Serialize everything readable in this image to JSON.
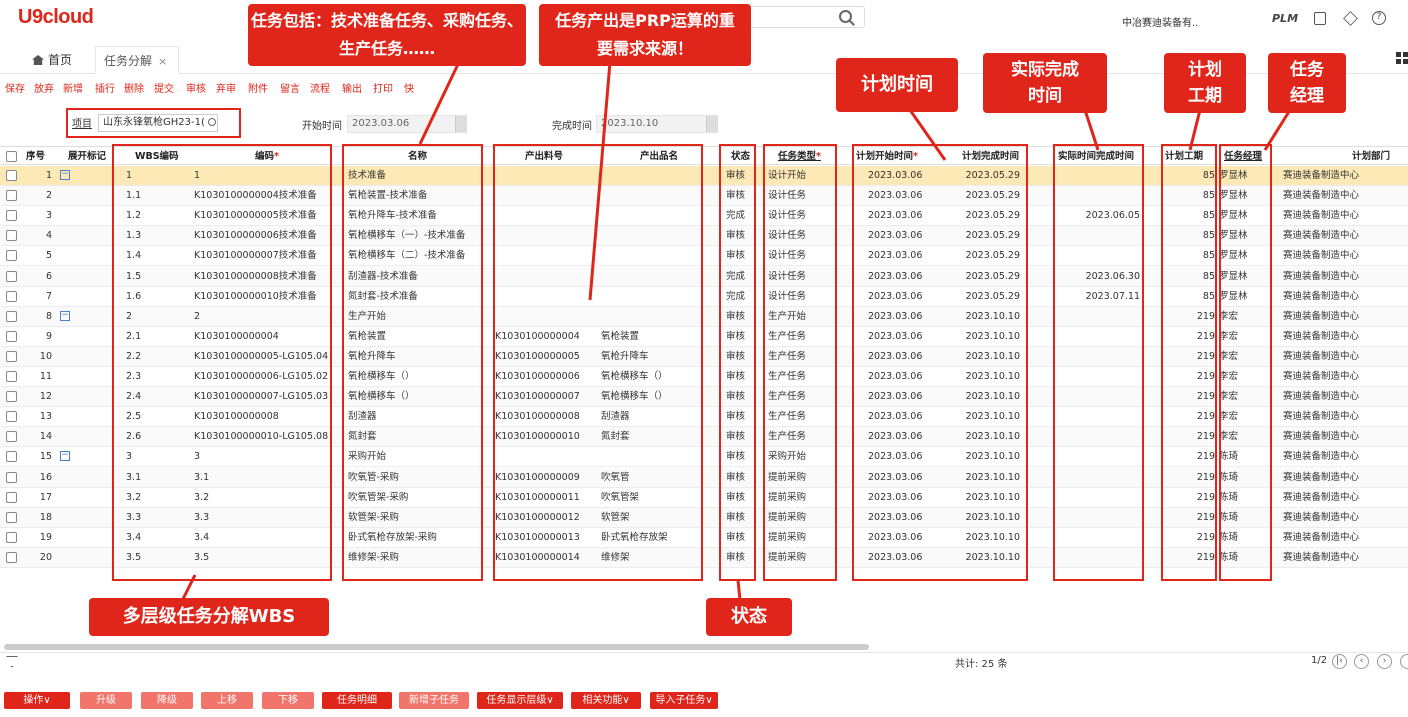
{
  "app": {
    "logo": "U9cloud",
    "org": "中冶赛迪装备有..",
    "plm": "PLM"
  },
  "tabs": {
    "home": "首页",
    "active": "任务分解",
    "close": "×"
  },
  "toolbar": [
    "保存",
    "放弃",
    "新增",
    "插行",
    "删除",
    "提交",
    "审核",
    "弃审",
    "附件",
    "留言",
    "流程",
    "输出",
    "打印",
    "快"
  ],
  "filter": {
    "project_label": "项目",
    "project_value": "山东永锋氧枪GH23-1(",
    "start_label": "开始时间",
    "start_value": "2023.03.06",
    "end_label": "完成时间",
    "end_value": "2023.10.10"
  },
  "columns": {
    "seq": "序号",
    "expand": "展开标记",
    "wbs": "WBS编码",
    "code": "编码",
    "name": "名称",
    "item_no": "产出料号",
    "item_name": "产出品名",
    "status": "状态",
    "type": "任务类型",
    "plan_start": "计划开始时间",
    "plan_end": "计划完成时间",
    "actual_end": "实际时间完成时间",
    "duration": "计划工期",
    "manager": "任务经理",
    "dept": "计划部门"
  },
  "rows": [
    {
      "seq": "1",
      "exp": true,
      "wbs": "1",
      "code": "1",
      "name": "技术准备",
      "ino": "",
      "iname": "",
      "status": "审核",
      "type": "设计开始",
      "ps": "2023.03.06",
      "pe": "2023.05.29",
      "ae": "",
      "dur": "85",
      "mgr": "罗显林",
      "dept": "赛迪装备制造中心"
    },
    {
      "seq": "2",
      "exp": false,
      "wbs": "1.1",
      "code": "K1030100000004技术准备",
      "name": "氧枪装置-技术准备",
      "ino": "",
      "iname": "",
      "status": "审核",
      "type": "设计任务",
      "ps": "2023.03.06",
      "pe": "2023.05.29",
      "ae": "",
      "dur": "85",
      "mgr": "罗显林",
      "dept": "赛迪装备制造中心"
    },
    {
      "seq": "3",
      "exp": false,
      "wbs": "1.2",
      "code": "K1030100000005技术准备",
      "name": "氧枪升降车-技术准备",
      "ino": "",
      "iname": "",
      "status": "完成",
      "type": "设计任务",
      "ps": "2023.03.06",
      "pe": "2023.05.29",
      "ae": "2023.06.05",
      "dur": "85",
      "mgr": "罗显林",
      "dept": "赛迪装备制造中心"
    },
    {
      "seq": "4",
      "exp": false,
      "wbs": "1.3",
      "code": "K1030100000006技术准备",
      "name": "氧枪横移车（一）-技术准备",
      "ino": "",
      "iname": "",
      "status": "审核",
      "type": "设计任务",
      "ps": "2023.03.06",
      "pe": "2023.05.29",
      "ae": "",
      "dur": "85",
      "mgr": "罗显林",
      "dept": "赛迪装备制造中心"
    },
    {
      "seq": "5",
      "exp": false,
      "wbs": "1.4",
      "code": "K1030100000007技术准备",
      "name": "氧枪横移车（二）-技术准备",
      "ino": "",
      "iname": "",
      "status": "审核",
      "type": "设计任务",
      "ps": "2023.03.06",
      "pe": "2023.05.29",
      "ae": "",
      "dur": "85",
      "mgr": "罗显林",
      "dept": "赛迪装备制造中心"
    },
    {
      "seq": "6",
      "exp": false,
      "wbs": "1.5",
      "code": "K1030100000008技术准备",
      "name": "刮渣器-技术准备",
      "ino": "",
      "iname": "",
      "status": "完成",
      "type": "设计任务",
      "ps": "2023.03.06",
      "pe": "2023.05.29",
      "ae": "2023.06.30",
      "dur": "85",
      "mgr": "罗显林",
      "dept": "赛迪装备制造中心"
    },
    {
      "seq": "7",
      "exp": false,
      "wbs": "1.6",
      "code": "K1030100000010技术准备",
      "name": "氮封套-技术准备",
      "ino": "",
      "iname": "",
      "status": "完成",
      "type": "设计任务",
      "ps": "2023.03.06",
      "pe": "2023.05.29",
      "ae": "2023.07.11",
      "dur": "85",
      "mgr": "罗显林",
      "dept": "赛迪装备制造中心"
    },
    {
      "seq": "8",
      "exp": true,
      "wbs": "2",
      "code": "2",
      "name": "生产开始",
      "ino": "",
      "iname": "",
      "status": "审核",
      "type": "生产开始",
      "ps": "2023.03.06",
      "pe": "2023.10.10",
      "ae": "",
      "dur": "219",
      "mgr": "李宏",
      "dept": "赛迪装备制造中心"
    },
    {
      "seq": "9",
      "exp": false,
      "wbs": "2.1",
      "code": "K1030100000004",
      "name": "氧枪装置",
      "ino": "K1030100000004",
      "iname": "氧枪装置",
      "status": "审核",
      "type": "生产任务",
      "ps": "2023.03.06",
      "pe": "2023.10.10",
      "ae": "",
      "dur": "219",
      "mgr": "李宏",
      "dept": "赛迪装备制造中心"
    },
    {
      "seq": "10",
      "exp": false,
      "wbs": "2.2",
      "code": "K1030100000005-LG105.04",
      "name": "氧枪升降车",
      "ino": "K1030100000005",
      "iname": "氧枪升降车",
      "status": "审核",
      "type": "生产任务",
      "ps": "2023.03.06",
      "pe": "2023.10.10",
      "ae": "",
      "dur": "219",
      "mgr": "李宏",
      "dept": "赛迪装备制造中心"
    },
    {
      "seq": "11",
      "exp": false,
      "wbs": "2.3",
      "code": "K1030100000006-LG105.02",
      "name": "氧枪横移车（）",
      "ino": "K1030100000006",
      "iname": "氧枪横移车（）",
      "status": "审核",
      "type": "生产任务",
      "ps": "2023.03.06",
      "pe": "2023.10.10",
      "ae": "",
      "dur": "219",
      "mgr": "李宏",
      "dept": "赛迪装备制造中心"
    },
    {
      "seq": "12",
      "exp": false,
      "wbs": "2.4",
      "code": "K1030100000007-LG105.03",
      "name": "氧枪横移车（）",
      "ino": "K1030100000007",
      "iname": "氧枪横移车（）",
      "status": "审核",
      "type": "生产任务",
      "ps": "2023.03.06",
      "pe": "2023.10.10",
      "ae": "",
      "dur": "219",
      "mgr": "李宏",
      "dept": "赛迪装备制造中心"
    },
    {
      "seq": "13",
      "exp": false,
      "wbs": "2.5",
      "code": "K1030100000008",
      "name": "刮渣器",
      "ino": "K1030100000008",
      "iname": "刮渣器",
      "status": "审核",
      "type": "生产任务",
      "ps": "2023.03.06",
      "pe": "2023.10.10",
      "ae": "",
      "dur": "219",
      "mgr": "李宏",
      "dept": "赛迪装备制造中心"
    },
    {
      "seq": "14",
      "exp": false,
      "wbs": "2.6",
      "code": "K1030100000010-LG105.08",
      "name": "氮封套",
      "ino": "K1030100000010",
      "iname": "氮封套",
      "status": "审核",
      "type": "生产任务",
      "ps": "2023.03.06",
      "pe": "2023.10.10",
      "ae": "",
      "dur": "219",
      "mgr": "李宏",
      "dept": "赛迪装备制造中心"
    },
    {
      "seq": "15",
      "exp": true,
      "wbs": "3",
      "code": "3",
      "name": "采购开始",
      "ino": "",
      "iname": "",
      "status": "审核",
      "type": "采购开始",
      "ps": "2023.03.06",
      "pe": "2023.10.10",
      "ae": "",
      "dur": "219",
      "mgr": "陈琦",
      "dept": "赛迪装备制造中心"
    },
    {
      "seq": "16",
      "exp": false,
      "wbs": "3.1",
      "code": "3.1",
      "name": "吹氧管-采购",
      "ino": "K1030100000009",
      "iname": "吹氧管",
      "status": "审核",
      "type": "提前采购",
      "ps": "2023.03.06",
      "pe": "2023.10.10",
      "ae": "",
      "dur": "219",
      "mgr": "陈琦",
      "dept": "赛迪装备制造中心"
    },
    {
      "seq": "17",
      "exp": false,
      "wbs": "3.2",
      "code": "3.2",
      "name": "吹氧管架-采购",
      "ino": "K1030100000011",
      "iname": "吹氧管架",
      "status": "审核",
      "type": "提前采购",
      "ps": "2023.03.06",
      "pe": "2023.10.10",
      "ae": "",
      "dur": "219",
      "mgr": "陈琦",
      "dept": "赛迪装备制造中心"
    },
    {
      "seq": "18",
      "exp": false,
      "wbs": "3.3",
      "code": "3.3",
      "name": "软管架-采购",
      "ino": "K1030100000012",
      "iname": "软管架",
      "status": "审核",
      "type": "提前采购",
      "ps": "2023.03.06",
      "pe": "2023.10.10",
      "ae": "",
      "dur": "219",
      "mgr": "陈琦",
      "dept": "赛迪装备制造中心"
    },
    {
      "seq": "19",
      "exp": false,
      "wbs": "3.4",
      "code": "3.4",
      "name": "卧式氧枪存放架-采购",
      "ino": "K1030100000013",
      "iname": "卧式氧枪存放架",
      "status": "审核",
      "type": "提前采购",
      "ps": "2023.03.06",
      "pe": "2023.10.10",
      "ae": "",
      "dur": "219",
      "mgr": "陈琦",
      "dept": "赛迪装备制造中心"
    },
    {
      "seq": "20",
      "exp": false,
      "wbs": "3.5",
      "code": "3.5",
      "name": "维修架-采购",
      "ino": "K1030100000014",
      "iname": "维修架",
      "status": "审核",
      "type": "提前采购",
      "ps": "2023.03.06",
      "pe": "2023.10.10",
      "ae": "",
      "dur": "219",
      "mgr": "陈琦",
      "dept": "赛迪装备制造中心"
    }
  ],
  "footer": {
    "total": "共计: 25 条",
    "page": "1/2"
  },
  "bottom_buttons": [
    "操作∨",
    "升级",
    "降级",
    "上移",
    "下移",
    "任务明细",
    "新增子任务",
    "任务显示层级∨",
    "相关功能∨",
    "导入子任务∨"
  ],
  "annotations": {
    "task_types": "任务包括：技术准备任务、采购任务、生产任务……",
    "prp": "任务产出是PRP运算的重要需求来源！",
    "plan_time": "计划时间",
    "actual": "实际完成时间",
    "duration": "计划工期",
    "manager": "任务经理",
    "wbs": "多层级任务分解WBS",
    "status": "状态"
  },
  "colors": {
    "brand": "#e0251a",
    "selected_row": "#fde9b5"
  }
}
